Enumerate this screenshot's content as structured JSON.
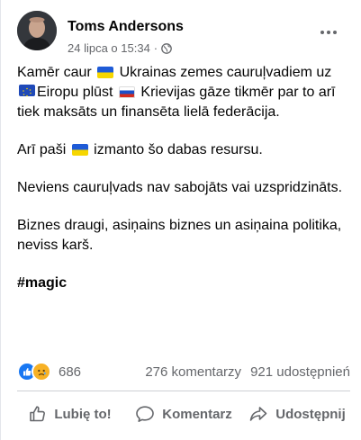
{
  "post": {
    "author": "Toms Andersons",
    "timestamp": "24 lipca o 15:34",
    "separator": "·",
    "privacy_icon": "globe-icon",
    "body": {
      "p1_a": "Kamēr caur",
      "p1_b": "Ukrainas zemes cauruļvadiem uz",
      "p1_c": "Eiropu plūst",
      "p1_d": "Krievijas gāze tikmēr par to arī tiek maksāts un finansēta lielā federācija.",
      "p2_a": "Arī paši",
      "p2_b": "izmanto šo dabas resursu.",
      "p3": "Neviens cauruļvads nav sabojāts vai uzspridzināts.",
      "p4": "Biznes draugi, asiņains biznes un asiņaina politika, neviss karš.",
      "hashtag": "#magic"
    },
    "flags": [
      "ukraine-flag",
      "eu-flag",
      "russia-flag"
    ]
  },
  "stats": {
    "reaction_icons": [
      "like-icon",
      "sad-icon"
    ],
    "reactions_count": "686",
    "comments": "276 komentarzy",
    "shares": "921 udostępnień"
  },
  "actions": {
    "like": "Lubię to!",
    "comment": "Komentarz",
    "share": "Udostępnij"
  },
  "colors": {
    "text": "#050505",
    "secondary": "#65676b",
    "like_blue": "#1877f2",
    "sad_yellow": "#f7b125"
  }
}
